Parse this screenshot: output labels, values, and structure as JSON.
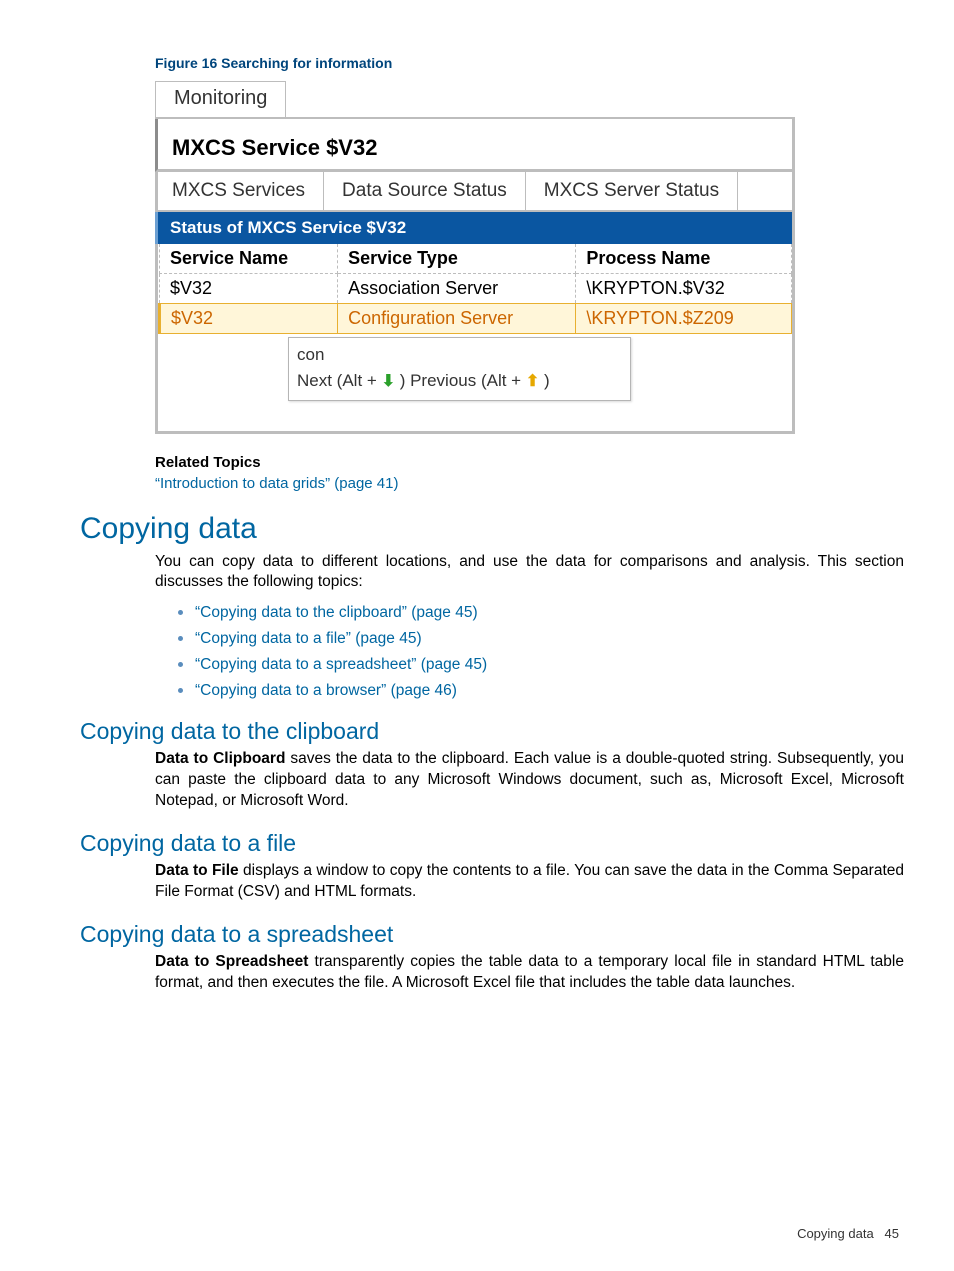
{
  "figure": {
    "caption": "Figure 16 Searching for information",
    "topTab": "Monitoring",
    "panelTitle": "MXCS Service $V32",
    "subTabs": [
      "MXCS Services",
      "Data Source Status",
      "MXCS Server Status"
    ],
    "blueBar": "Status of MXCS Service $V32",
    "columns": [
      "Service Name",
      "Service Type",
      "Process Name"
    ],
    "rows": [
      {
        "serviceName": "$V32",
        "serviceType": "Association Server",
        "processName": "\\KRYPTON.$V32",
        "highlight": false
      },
      {
        "serviceName": "$V32",
        "serviceType": "Configuration Server",
        "processName": "\\KRYPTON.$Z209",
        "highlight": true
      }
    ],
    "search": {
      "value": "con",
      "nextLabel": "Next (Alt + ",
      "nextSuffix": " )",
      "prevLabel": "Previous (Alt + ",
      "prevSuffix": " )"
    }
  },
  "related": {
    "title": "Related Topics",
    "link": "“Introduction to data grids” (page 41)"
  },
  "sections": {
    "copyingData": {
      "title": "Copying data",
      "intro": "You can copy data to different locations, and use the data for comparisons and analysis. This section discusses the following topics:",
      "bullets": [
        "“Copying data to the clipboard” (page 45)",
        "“Copying data to a file” (page 45)",
        "“Copying data to a spreadsheet” (page 45)",
        "“Copying data to a browser” (page 46)"
      ]
    },
    "clipboard": {
      "title": "Copying data to the clipboard",
      "strong": "Data to Clipboard",
      "text": " saves the data to the clipboard. Each value is a double-quoted string. Subsequently, you can paste the clipboard data to any Microsoft Windows document, such as, Microsoft Excel, Microsoft Notepad, or Microsoft Word."
    },
    "file": {
      "title": "Copying data to a file",
      "strong": "Data to File",
      "text": " displays a window to copy the contents to a file. You can save the data in the Comma Separated File Format (CSV) and HTML formats."
    },
    "spreadsheet": {
      "title": "Copying data to a spreadsheet",
      "strong": "Data to Spreadsheet",
      "text": " transparently copies the table data to a temporary local file in standard HTML table format, and then executes the file. A Microsoft Excel file that includes the table data launches."
    }
  },
  "footer": {
    "label": "Copying data",
    "page": "45"
  }
}
